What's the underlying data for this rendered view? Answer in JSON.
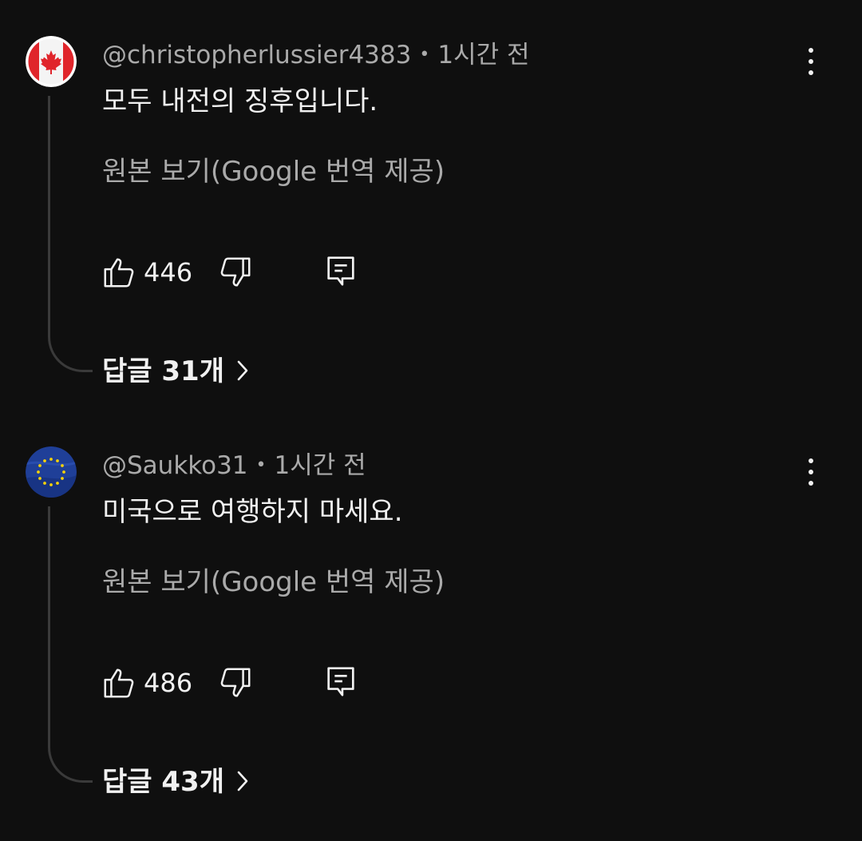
{
  "comments": [
    {
      "handle": "@christopherlussier4383",
      "time": "1시간 전",
      "text": "모두 내전의 징후입니다.",
      "translate_link": "원본 보기(Google 번역 제공)",
      "likes": "446",
      "replies_label": "답글 31개",
      "avatar_icon": "canada-flag-icon"
    },
    {
      "handle": "@Saukko31",
      "time": "1시간 전",
      "text": "미국으로 여행하지 마세요.",
      "translate_link": "원본 보기(Google 번역 제공)",
      "likes": "486",
      "replies_label": "답글 43개",
      "avatar_icon": "eu-flag-icon"
    }
  ],
  "separator": "•",
  "icons": {
    "like": "thumbs-up-icon",
    "dislike": "thumbs-down-icon",
    "reply": "reply-icon",
    "more": "more-vert-icon",
    "chevron": "chevron-right-icon"
  },
  "colors": {
    "background": "#0f0f0f",
    "primary_text": "#f1f1f1",
    "secondary_text": "#aaaaaa",
    "thread_line": "#3a3a3a",
    "canada_red": "#e0252b",
    "eu_blue": "#1f3f98",
    "eu_star": "#f5d20a"
  }
}
